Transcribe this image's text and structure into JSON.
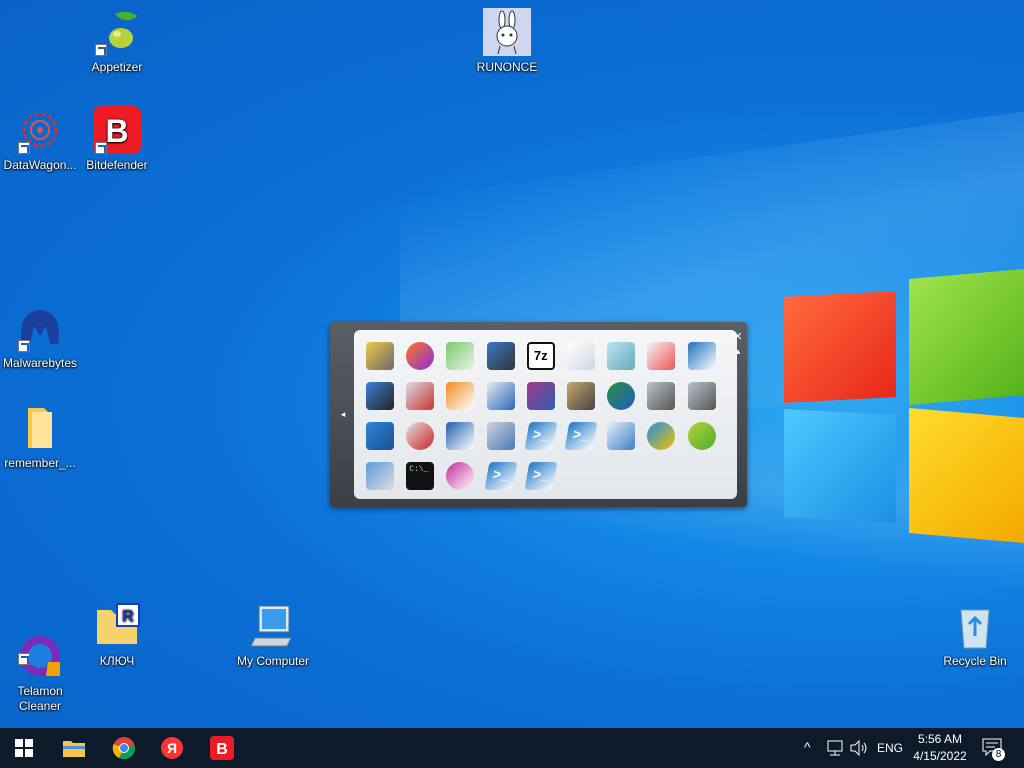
{
  "desktop": {
    "icons": [
      {
        "label": "Appetizer",
        "icon": "olive-icon"
      },
      {
        "label": "RUNONCE",
        "icon": "bunny-icon"
      },
      {
        "label": "DataWagon...",
        "icon": "gear-web-icon"
      },
      {
        "label": "Bitdefender",
        "icon": "bitdefender-icon"
      },
      {
        "label": "Malwarebytes",
        "icon": "malwarebytes-icon"
      },
      {
        "label": "remember_...",
        "icon": "folder-icon"
      },
      {
        "label": "Telamon\nCleaner",
        "icon": "telamon-icon"
      },
      {
        "label": "КЛЮЧ",
        "icon": "folder-r-icon"
      },
      {
        "label": "My Computer",
        "icon": "computer-icon"
      },
      {
        "label": "Recycle Bin",
        "icon": "recycle-bin-icon"
      }
    ]
  },
  "dock": {
    "close_glyph": "✕",
    "up_glyph": "▲",
    "collapse_glyph": "◂",
    "icons": [
      "cross-tool-icon",
      "firefox-icon",
      "notepadpp-icon",
      "lock-icon",
      "7zip-icon",
      "blank-doc-icon",
      "notepad-icon",
      "paint-icon",
      "remote-desktop-icon",
      "network-computer-icon",
      "media-stop-icon",
      "media-player-icon",
      "wordpad-icon",
      "winrar-icon",
      "scanner-icon",
      "globe-shield-icon",
      "toolbox-icon",
      "toolbox2-icon",
      "cube-gear-icon",
      "compass-icon",
      "info-monitor-icon",
      "performance-icon",
      "powershell-icon",
      "powershell2-icon",
      "magnifier-icon",
      "ie-icon",
      "olive-icon",
      "control-panel-icon",
      "cmd-icon",
      "opera-icon",
      "powershell3-icon",
      "powershell4-icon"
    ]
  },
  "taskbar": {
    "apps": [
      "start-icon",
      "file-explorer-icon",
      "chrome-icon",
      "yandex-icon",
      "bitdefender-icon"
    ],
    "tray": {
      "language": "ENG",
      "time": "5:56 AM",
      "date": "4/15/2022",
      "notifications": "8",
      "chevron": "^"
    }
  },
  "colors": {
    "taskbar": "#0d1a2a",
    "desktop": "#0a6fd6"
  }
}
